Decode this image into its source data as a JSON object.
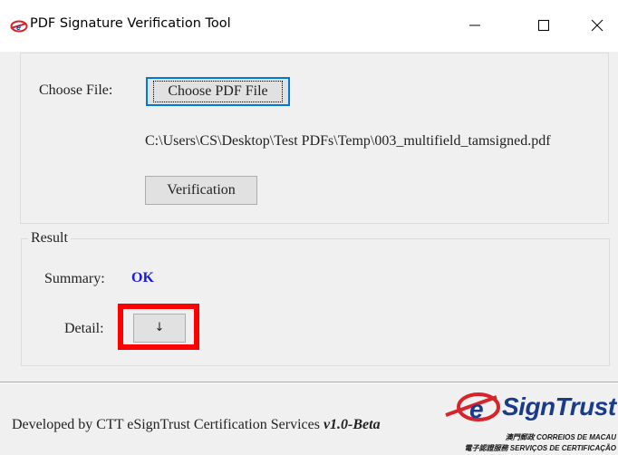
{
  "window": {
    "title": "PDF Signature Verification Tool",
    "icon": "esigntrust-app-icon",
    "controls": [
      "minimize-icon",
      "maximize-icon",
      "close-icon"
    ]
  },
  "file_section": {
    "choose_label": "Choose File:",
    "choose_button": "Choose PDF File",
    "file_path": "C:\\Users\\CS\\Desktop\\Test PDFs\\Temp\\003_multifield_tamsigned.pdf",
    "verify_button": "Verification"
  },
  "result": {
    "group_label": "Result",
    "summary_label": "Summary:",
    "summary_value": "OK",
    "summary_color": "#1a1adc",
    "detail_label": "Detail:",
    "detail_button": "↓"
  },
  "footer": {
    "developer_text": "Developed by CTT eSignTrust Certification Services",
    "version": "v1.0-Beta"
  },
  "logo": {
    "name": "SignTrust",
    "line1": "澳門郵政 CORREIOS DE MACAU",
    "line2": "電子認證服務 SERVIÇOS DE CERTIFICAÇÃO",
    "brand_red": "#d7242a",
    "brand_blue": "#1a3a8c"
  },
  "highlight_color": "#ff0000"
}
